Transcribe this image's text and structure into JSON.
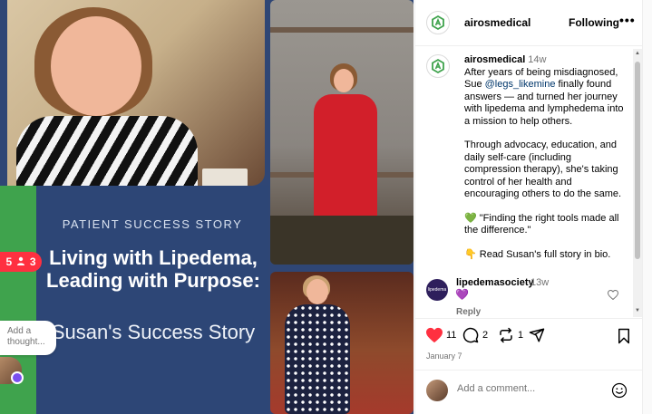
{
  "image_panel": {
    "eyebrow": "PATIENT SUCCESS STORY",
    "title": "Living with Lipedema, Leading with Purpose:",
    "subtitle": "Susan's Success Story",
    "notification_count_a": "5",
    "notification_count_b": "3",
    "note_placeholder": "Add a thought..."
  },
  "header": {
    "username": "airosmedical",
    "follow_label": "Following",
    "more_icon": "more-horizontal-icon"
  },
  "caption": {
    "username": "airosmedical",
    "time": "14w",
    "text_before_mention": "After years of being misdiagnosed, Sue ",
    "mention": "@legs_likemine",
    "text_after_mention": " finally found answers — and turned her journey with lipedema and lymphedema into a mission to help others.",
    "paragraph_2": "Through advocacy, education, and daily self-care (including compression therapy), she's taking control of her health and encouraging others to do the same.",
    "quote": "💚 \"Finding the right tools made all the difference.\"",
    "cta": "👇 Read Susan's full story in bio."
  },
  "comment": {
    "username": "lipedemasociety",
    "time": "13w",
    "text": "💜",
    "avatar_text": "lipedema",
    "reply_label": "Reply"
  },
  "actions": {
    "likes": "11",
    "comments": "2",
    "shares": "1",
    "date": "January 7"
  },
  "add_comment": {
    "placeholder": "Add a comment..."
  },
  "colors": {
    "like_red": "#ff3040",
    "brand_green": "#3fa34d",
    "panel_blue": "#2d4676",
    "link_blue": "#00376b"
  }
}
